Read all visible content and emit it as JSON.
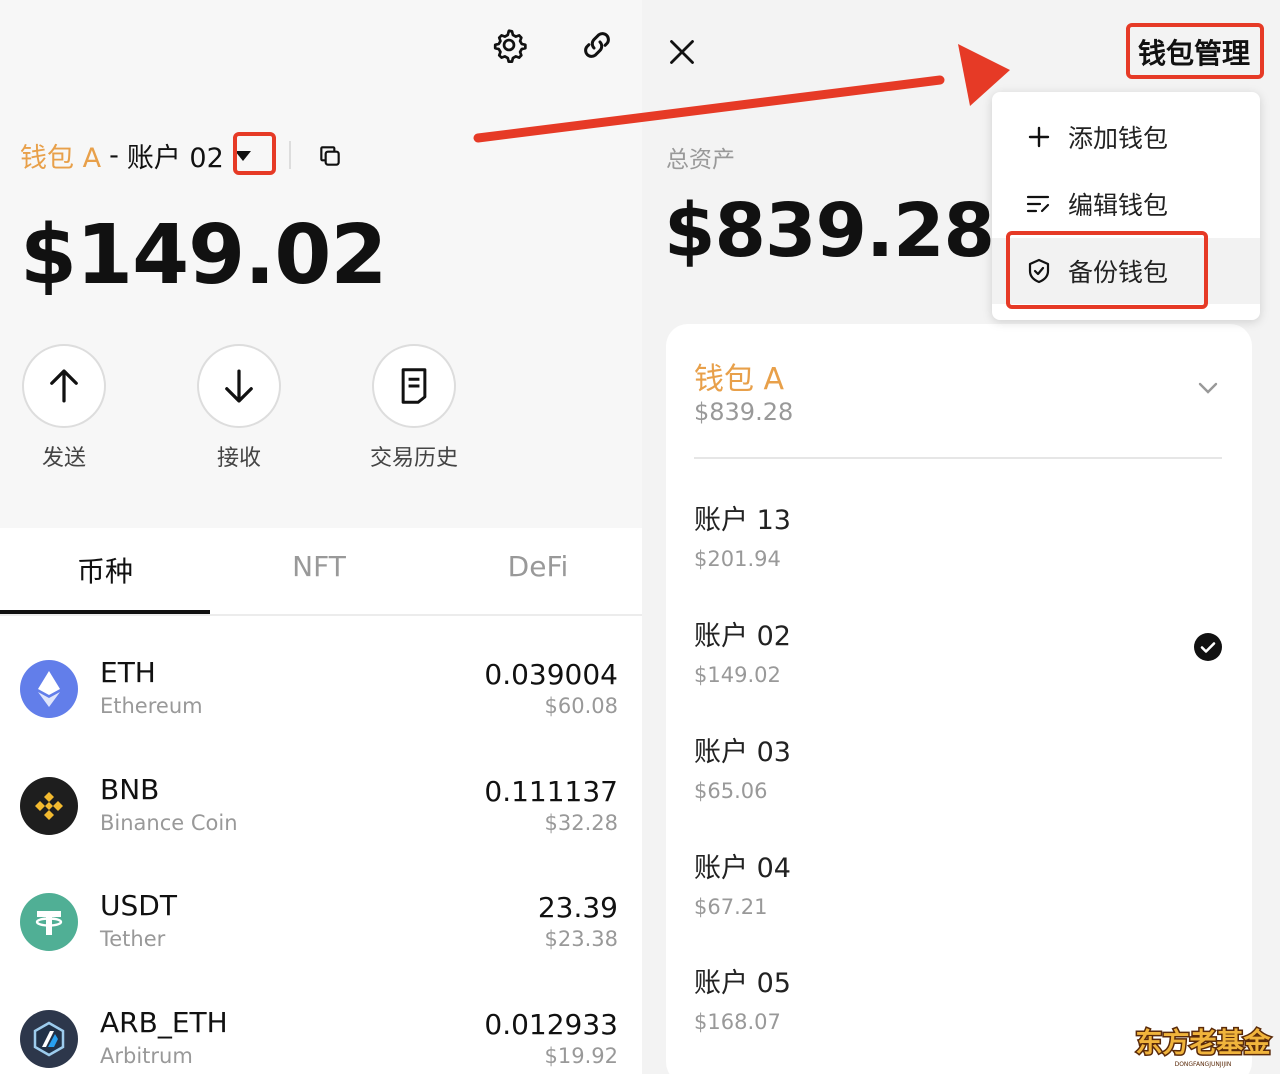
{
  "left": {
    "wallet_name": "钱包 A",
    "separator": "-",
    "account_name": "账户 02",
    "balance": "$149.02",
    "actions": [
      {
        "label": "发送",
        "icon": "arrow-up-icon"
      },
      {
        "label": "接收",
        "icon": "arrow-down-icon"
      },
      {
        "label": "交易历史",
        "icon": "document-icon"
      }
    ],
    "tabs": [
      {
        "label": "币种",
        "active": true
      },
      {
        "label": "NFT",
        "active": false
      },
      {
        "label": "DeFi",
        "active": false
      }
    ],
    "coins": [
      {
        "symbol": "ETH",
        "name": "Ethereum",
        "amount": "0.039004",
        "usd": "$60.08",
        "icon": "ethereum-icon",
        "color": "#627eea"
      },
      {
        "symbol": "BNB",
        "name": "Binance Coin",
        "amount": "0.111137",
        "usd": "$32.28",
        "icon": "bnb-icon",
        "color": "#1e1e1e"
      },
      {
        "symbol": "USDT",
        "name": "Tether",
        "amount": "23.39",
        "usd": "$23.38",
        "icon": "tether-icon",
        "color": "#50af95"
      },
      {
        "symbol": "ARB_ETH",
        "name": "Arbitrum",
        "amount": "0.012933",
        "usd": "$19.92",
        "icon": "arbitrum-icon",
        "color": "#2d374b"
      }
    ]
  },
  "right": {
    "title": "钱包管理",
    "total_label": "总资产",
    "total_value": "$839.28",
    "menu": [
      {
        "label": "添加钱包",
        "icon": "plus-icon"
      },
      {
        "label": "编辑钱包",
        "icon": "edit-list-icon"
      },
      {
        "label": "备份钱包",
        "icon": "shield-icon"
      }
    ],
    "wallet": {
      "name": "钱包 A",
      "value": "$839.28"
    },
    "accounts": [
      {
        "name": "账户 13",
        "value": "$201.94",
        "selected": false
      },
      {
        "name": "账户 02",
        "value": "$149.02",
        "selected": true
      },
      {
        "name": "账户 03",
        "value": "$65.06",
        "selected": false
      },
      {
        "name": "账户 04",
        "value": "$67.21",
        "selected": false
      },
      {
        "name": "账户 05",
        "value": "$168.07",
        "selected": false
      }
    ]
  },
  "watermark": {
    "text": "东方老基金",
    "subtext": "DONGFANGJUNJIJIN"
  },
  "colors": {
    "accent": "#e8a04a",
    "highlight": "#e63a26"
  }
}
